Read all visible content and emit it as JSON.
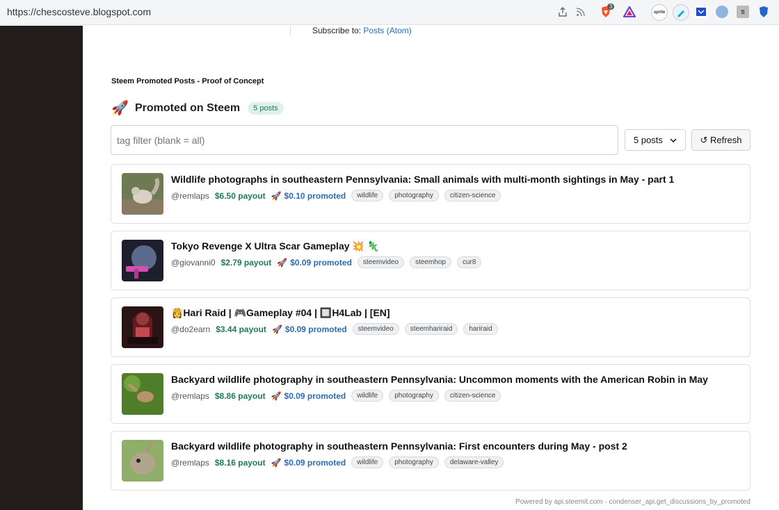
{
  "browser": {
    "url": "https://chescosteve.blogspot.com",
    "brave_badge": "3",
    "ext_sprite": "sprite",
    "ext_s": "S"
  },
  "subscribe": {
    "label": "Subscribe to:",
    "link": "Posts (Atom)"
  },
  "gadget_title": "Steem Promoted Posts - Proof of Concept",
  "heading": {
    "icon": "🚀",
    "title": "Promoted on Steem",
    "badge": "5 posts"
  },
  "controls": {
    "filter_placeholder": "tag filter (blank = all)",
    "select_value": "5 posts",
    "refresh_label": "↺ Refresh"
  },
  "posts": [
    {
      "title": "Wildlife photographs in southeastern Pennsylvania: Small animals with multi-month sightings in May - part 1",
      "author": "@remlaps",
      "payout": "$6.50 payout",
      "promoted": "$0.10 promoted",
      "tags": [
        "wildlife",
        "photography",
        "citizen-science"
      ]
    },
    {
      "title": "Tokyo Revenge X Ultra Scar Gameplay 💥 🦎",
      "author": "@giovanni0",
      "payout": "$2.79 payout",
      "promoted": "$0.09 promoted",
      "tags": [
        "steemvideo",
        "steemhop",
        "cur8"
      ]
    },
    {
      "title": "👸Hari Raid | 🎮Gameplay #04 | 🔲H4Lab | [EN]",
      "author": "@do2earn",
      "payout": "$3.44 payout",
      "promoted": "$0.09 promoted",
      "tags": [
        "steemvideo",
        "steemhariraid",
        "hariraid"
      ]
    },
    {
      "title": "Backyard wildlife photography in southeastern Pennsylvania: Uncommon moments with the American Robin in May",
      "author": "@remlaps",
      "payout": "$8.86 payout",
      "promoted": "$0.09 promoted",
      "tags": [
        "wildlife",
        "photography",
        "citizen-science"
      ]
    },
    {
      "title": "Backyard wildlife photography in southeastern Pennsylvania: First encounters during May - post 2",
      "author": "@remlaps",
      "payout": "$8.16 payout",
      "promoted": "$0.09 promoted",
      "tags": [
        "wildlife",
        "photography",
        "delaware-valley"
      ]
    }
  ],
  "footer": "Powered by api.steemit.com · condenser_api.get_discussions_by_promoted",
  "colors": {
    "payout": "#1f7a55",
    "promoted": "#2a6cb3",
    "sidebar": "#221c1c"
  }
}
